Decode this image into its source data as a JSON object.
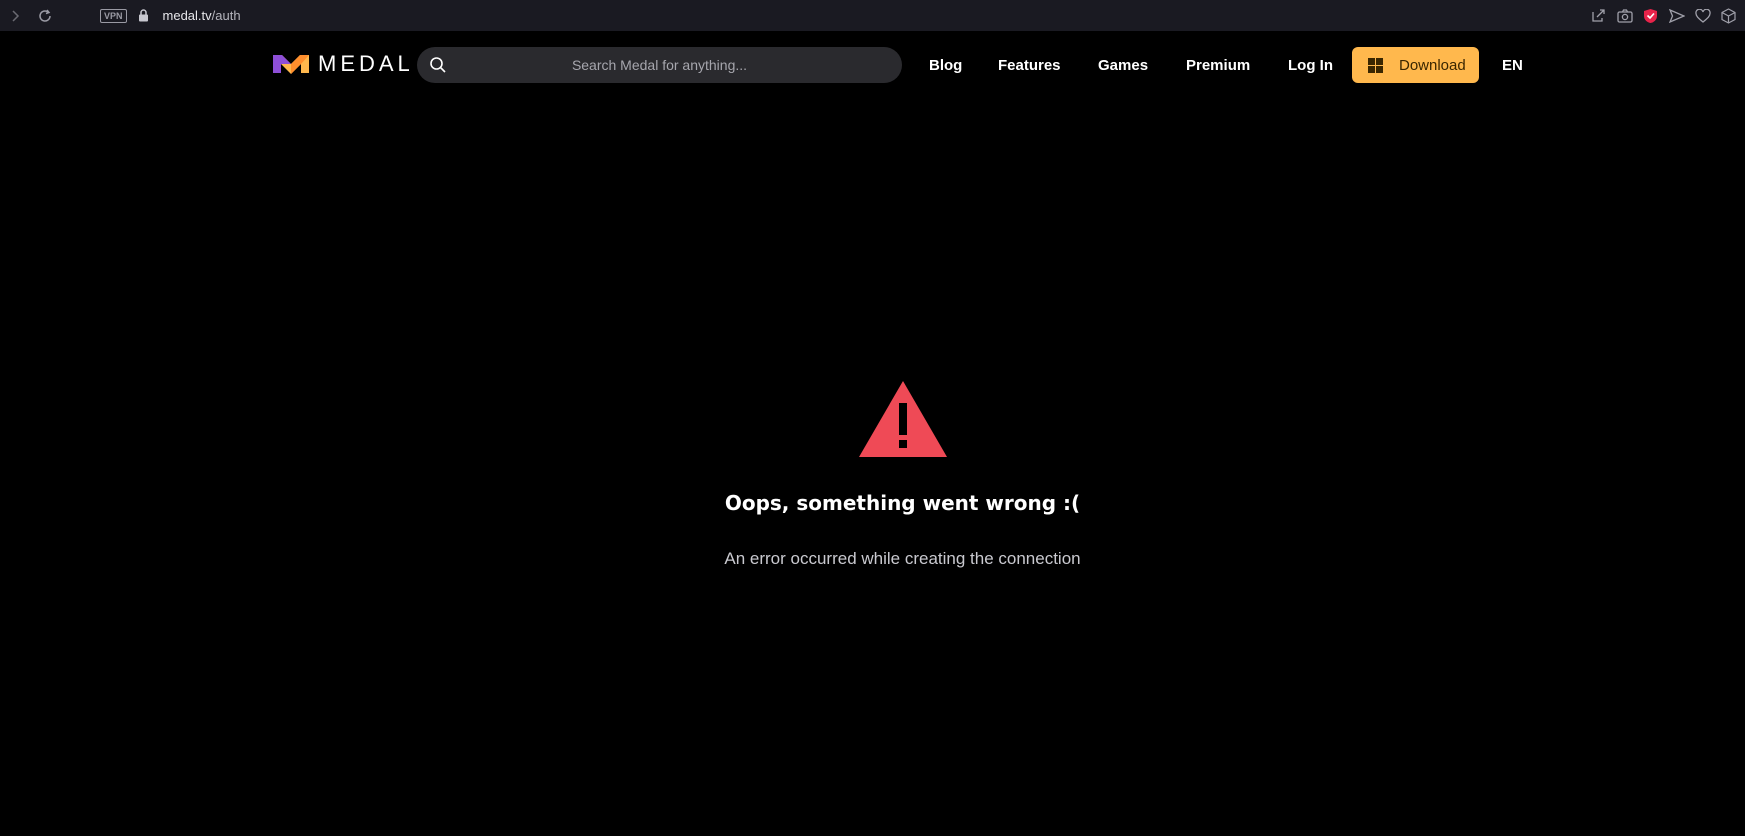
{
  "browser": {
    "vpn_label": "VPN",
    "url_host": "medal.tv",
    "url_path": "/auth"
  },
  "nav": {
    "logo_text": "MEDAL",
    "search_placeholder": "Search Medal for anything...",
    "links": {
      "blog": "Blog",
      "features": "Features",
      "games": "Games",
      "premium": "Premium",
      "login": "Log In"
    },
    "download_label": "Download",
    "language": "EN"
  },
  "error": {
    "title": "Oops, something went wrong :(",
    "message": "An error occurred while creating the connection"
  },
  "colors": {
    "download_bg": "#ffb84d",
    "warning_red": "#ef4a56",
    "page_bg": "#000000"
  }
}
